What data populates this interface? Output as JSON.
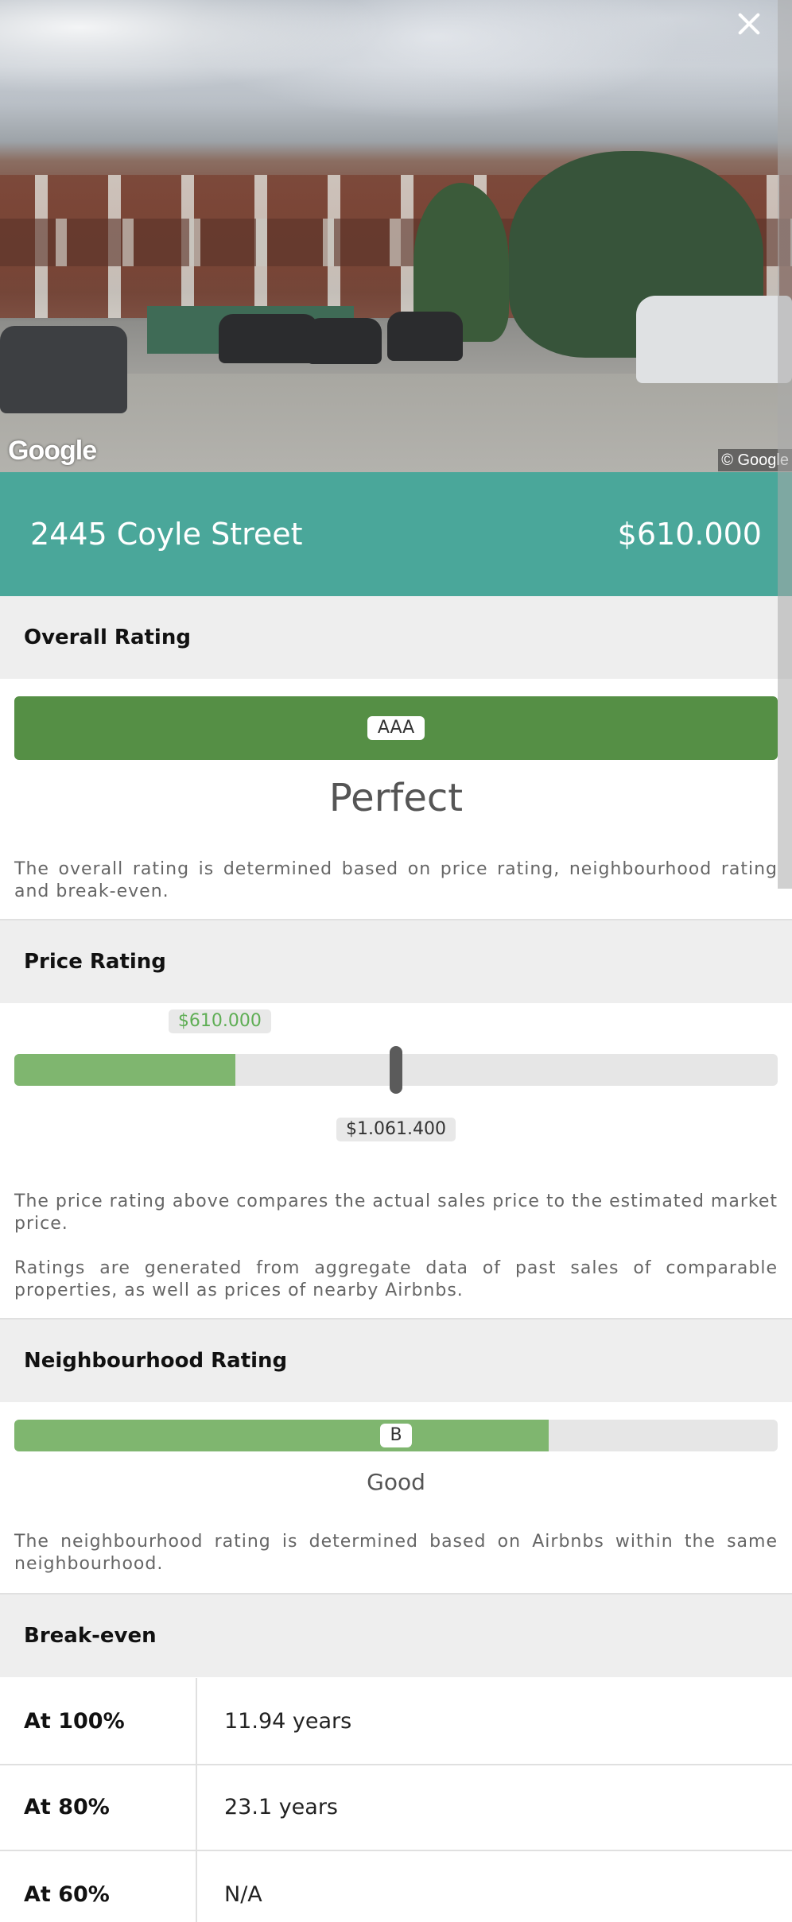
{
  "photo": {
    "provider_logo": "Google",
    "copyright": "© Google",
    "close_icon": "close-icon"
  },
  "header": {
    "address": "2445 Coyle Street",
    "price": "$610.000",
    "background_color": "#4aa79a"
  },
  "overall_rating": {
    "title": "Overall Rating",
    "grade": "AAA",
    "label": "Perfect",
    "description": "The overall rating is determined based on price rating, neighbourhood rating and break-even.",
    "bar_color": "#558f45"
  },
  "price_rating": {
    "title": "Price Rating",
    "actual_price_label": "$610.000",
    "estimated_price_label": "$1.061.400",
    "actual_fraction": 0.29,
    "estimated_fraction": 0.5,
    "description_1": "The price rating above compares the actual sales price to the estimated market price.",
    "description_2": "Ratings are generated from aggregate data of past sales of comparable properties, as well as prices of nearby Airbnbs.",
    "fill_color": "#7fb66f",
    "actual_tag_color": "#5fae55"
  },
  "neighbourhood_rating": {
    "title": "Neighbourhood Rating",
    "grade": "B",
    "label": "Good",
    "fill_fraction": 0.7,
    "description": "The neighbourhood rating is determined based on Airbnbs within the same neighbourhood."
  },
  "break_even": {
    "title": "Break-even",
    "rows": [
      {
        "label": "At 100%",
        "value": "11.94 years"
      },
      {
        "label": "At 80%",
        "value": "23.1 years"
      },
      {
        "label": "At 60%",
        "value": "N/A"
      }
    ]
  }
}
